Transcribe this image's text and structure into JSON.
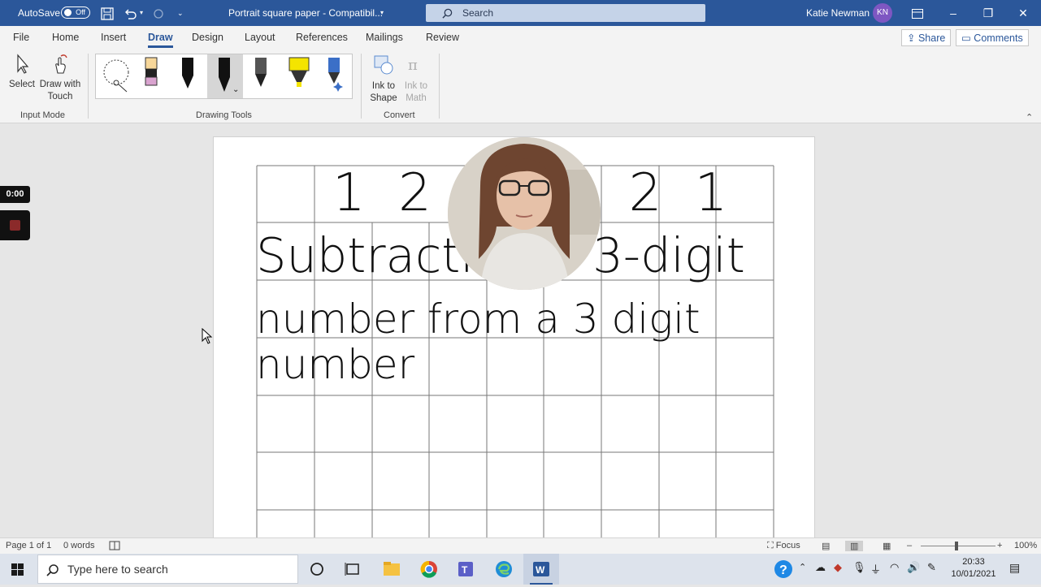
{
  "titlebar": {
    "autosave_label": "AutoSave",
    "autosave_state": "Off",
    "doc_title": "Portrait square paper  -  Compatibil...",
    "search_placeholder": "Search",
    "user_name": "Katie Newman",
    "user_initials": "KN",
    "accent": "#2b579a"
  },
  "tabs": [
    "File",
    "Home",
    "Insert",
    "Draw",
    "Design",
    "Layout",
    "References",
    "Mailings",
    "Review"
  ],
  "active_tab": "Draw",
  "share_label": "Share",
  "comments_label": "Comments",
  "ribbon": {
    "input_mode": {
      "label": "Input Mode",
      "select": "Select",
      "draw_touch_line1": "Draw with",
      "draw_touch_line2": "Touch"
    },
    "drawing_tools": {
      "label": "Drawing Tools"
    },
    "convert": {
      "label": "Convert",
      "ink_shape_line1": "Ink to",
      "ink_shape_line2": "Shape",
      "ink_math_line1": "Ink to",
      "ink_math_line2": "Math"
    }
  },
  "document": {
    "date_line": "1 2 . 1 . 2 1",
    "title_line1": "Subtracting a 3-digit",
    "title_line2": "number from a 3 digit number"
  },
  "recorder": {
    "timer": "0:00"
  },
  "statusbar": {
    "page": "Page 1 of 1",
    "words": "0 words",
    "focus": "Focus",
    "zoom": "100%"
  },
  "taskbar": {
    "search_placeholder": "Type here to search",
    "time": "20:33",
    "date": "10/01/2021"
  }
}
